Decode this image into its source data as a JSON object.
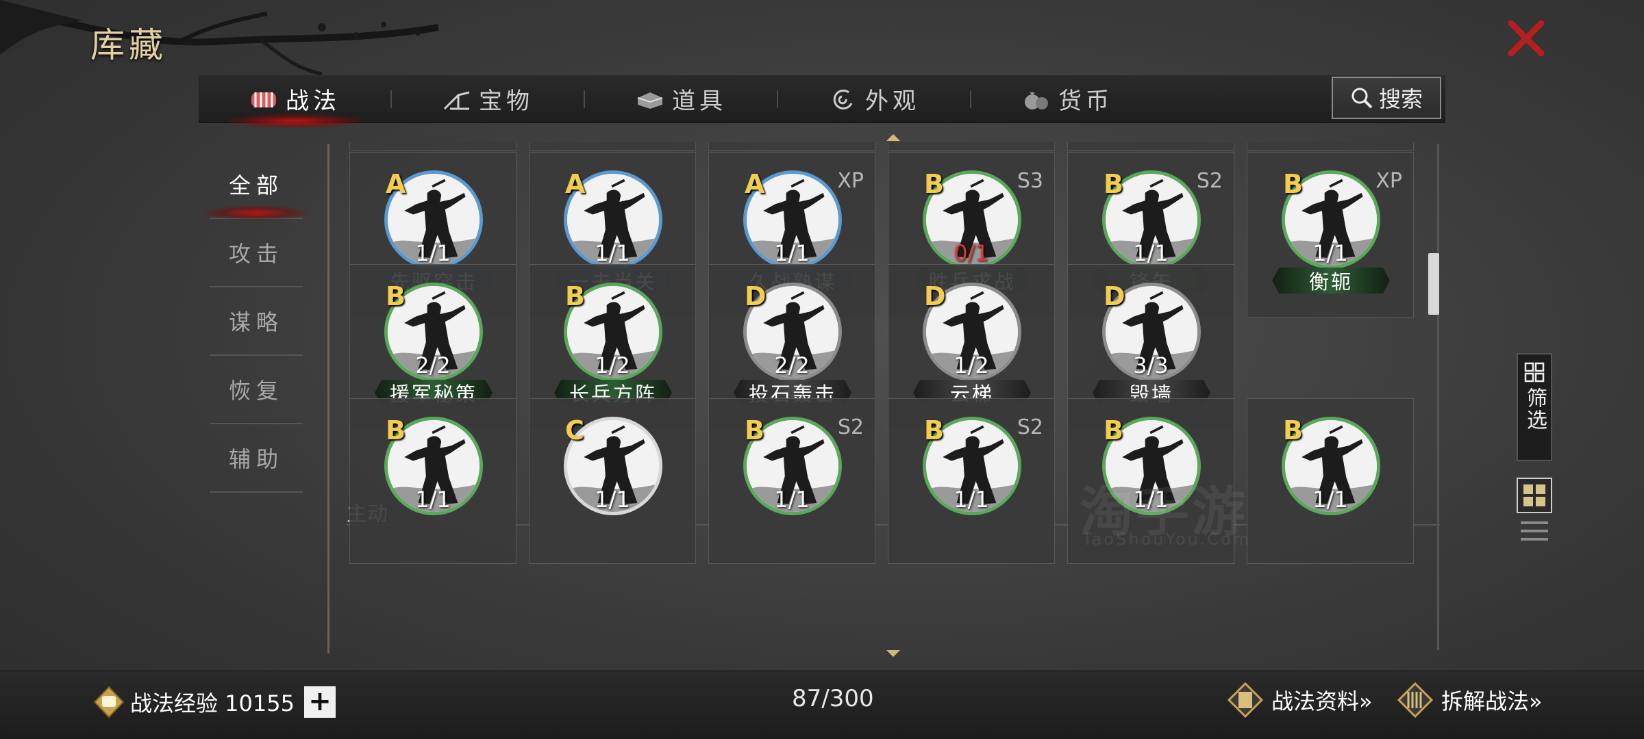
{
  "title": "库藏",
  "tabs": [
    {
      "label": "战法",
      "icon": "bundle-icon",
      "active": true
    },
    {
      "label": "宝物",
      "icon": "crossbow-icon",
      "active": false
    },
    {
      "label": "道具",
      "icon": "ingot-icon",
      "active": false
    },
    {
      "label": "外观",
      "icon": "swirl-icon",
      "active": false
    },
    {
      "label": "货币",
      "icon": "coin-bag-icon",
      "active": false
    }
  ],
  "search_label": "搜索",
  "categories": [
    {
      "label": "全部",
      "active": true
    },
    {
      "label": "攻击",
      "active": false
    },
    {
      "label": "谋略",
      "active": false
    },
    {
      "label": "恢复",
      "active": false
    },
    {
      "label": "辅助",
      "active": false
    }
  ],
  "section_title": "主动",
  "cards_row1": [
    {
      "grade": "A",
      "tag": "",
      "count": "1/1",
      "name": "先驱突击",
      "ring": "blue",
      "plate": "blue"
    },
    {
      "grade": "A",
      "tag": "",
      "count": "1/1",
      "name": "一夫当关",
      "ring": "blue",
      "plate": "blue"
    },
    {
      "grade": "A",
      "tag": "XP",
      "count": "1/1",
      "name": "久战熟谋",
      "ring": "blue",
      "plate": "blue"
    },
    {
      "grade": "B",
      "tag": "S3",
      "count": "0/1",
      "name": "胜兵求战",
      "ring": "green",
      "plate": "green",
      "count_red": true
    },
    {
      "grade": "B",
      "tag": "S2",
      "count": "1/1",
      "name": "锋矢",
      "ring": "green",
      "plate": "green"
    },
    {
      "grade": "B",
      "tag": "XP",
      "count": "1/1",
      "name": "衡轭",
      "ring": "green",
      "plate": "green"
    }
  ],
  "cards_row2": [
    {
      "grade": "B",
      "tag": "",
      "count": "2/2",
      "name": "援军秘策",
      "ring": "green",
      "plate": "green"
    },
    {
      "grade": "B",
      "tag": "",
      "count": "1/2",
      "name": "长兵方阵",
      "ring": "green",
      "plate": "green"
    },
    {
      "grade": "D",
      "tag": "",
      "count": "2/2",
      "name": "投石轰击",
      "ring": "grey",
      "plate": "grey"
    },
    {
      "grade": "D",
      "tag": "",
      "count": "1/2",
      "name": "云梯",
      "ring": "grey",
      "plate": "grey"
    },
    {
      "grade": "D",
      "tag": "",
      "count": "3/3",
      "name": "毁墙",
      "ring": "grey",
      "plate": "grey"
    }
  ],
  "cards_row3": [
    {
      "grade": "B",
      "tag": "",
      "count": "1/1",
      "ring": "green"
    },
    {
      "grade": "C",
      "tag": "",
      "count": "1/1",
      "ring": "white"
    },
    {
      "grade": "B",
      "tag": "S2",
      "count": "1/1",
      "ring": "green"
    },
    {
      "grade": "B",
      "tag": "S2",
      "count": "1/1",
      "ring": "green"
    },
    {
      "grade": "B",
      "tag": "",
      "count": "1/1",
      "ring": "green"
    },
    {
      "grade": "B",
      "tag": "",
      "count": "1/1",
      "ring": "green"
    }
  ],
  "filter_label": "筛选",
  "exp_label": "战法经验 10155",
  "capacity": "87/300",
  "link_info": "战法资料»",
  "link_disassemble": "拆解战法»",
  "watermark": "淘手游",
  "watermark_sub": "TaoShouYou.Com",
  "colors": {
    "accent_red": "#b21515",
    "title_gold": "#e2cfa2",
    "grade_gold": "#f3cd4f",
    "ring_blue": "#5a9ad0",
    "ring_green": "#5aa85a"
  }
}
